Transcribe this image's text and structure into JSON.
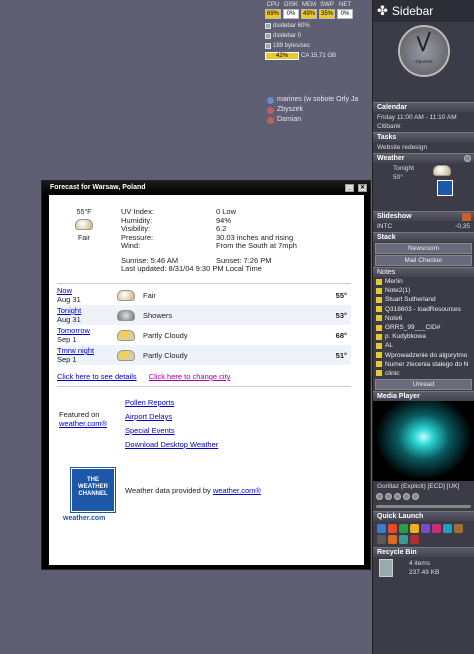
{
  "meters": {
    "headers": [
      "CPU",
      "DISK",
      "MEM",
      "SWP",
      "NET"
    ],
    "values": [
      "69%",
      "0%",
      "49%",
      "35%",
      "0%"
    ],
    "highlight": [
      true,
      false,
      true,
      true,
      false
    ],
    "net_in": "dsidebar 60%",
    "net_out": "dsidebar 0",
    "bytes": "189 bytes/sec",
    "disk_pct": "42%",
    "disk_label": "CA 15,71 GB"
  },
  "contacts": [
    {
      "name": "marines (w sobote Orly Ja"
    },
    {
      "name": "Zbyszek"
    },
    {
      "name": "Damian"
    }
  ],
  "forecast_window": {
    "title": "Forecast for Warsaw, Poland",
    "current": {
      "temp": "55°F",
      "condition": "Fair",
      "uv_label": "UV Index:",
      "uv": "0 Low",
      "humidity_label": "Humidity:",
      "humidity": "94%",
      "visibility_label": "Visibility:",
      "visibility": "6.2",
      "pressure_label": "Pressure:",
      "pressure": "30.03 inches and rising",
      "wind_label": "Wind:",
      "wind": "From the South at 7mph",
      "sunrise": "Sunrise: 5:46 AM",
      "sunset": "Sunset: 7:26 PM",
      "updated": "Last updated: 8/31/04 9:30 PM Local Time"
    },
    "days": [
      {
        "day": "Now",
        "date": "Aug 31",
        "condition": "Fair",
        "temp": "55°"
      },
      {
        "day": "Tonight",
        "date": "Aug 31",
        "condition": "Showers",
        "temp": "53°"
      },
      {
        "day": "Tomorrow",
        "date": "Sep 1",
        "condition": "Partly Cloudy",
        "temp": "68°"
      },
      {
        "day": "Tmrw night",
        "date": "Sep 1",
        "condition": "Partly Cloudy",
        "temp": "51°"
      }
    ],
    "details_link": "Click here to see details",
    "city_link": "Click here to change city",
    "featured": "Featured on",
    "featured_link": "weather.com®",
    "links": [
      "Pollen Reports",
      "Airport Delays",
      "Special Events",
      "Download Desktop Weather"
    ],
    "logo_text": "THE WEATHER CHANNEL",
    "logo_sub": "weather.com",
    "provided_by": "Weather data provided by",
    "provided_link": "weather.com®"
  },
  "sidebar": {
    "title": "Sidebar",
    "clock_label": "OpusOS",
    "calendar": {
      "label": "Calendar",
      "line1": "Friday 11:00 AM - 11:10 AM",
      "line2": "Citibank"
    },
    "tasks": {
      "label": "Tasks",
      "item": "Website redesign"
    },
    "weather": {
      "label": "Weather",
      "period": "Tonight",
      "temp": "50°"
    },
    "slideshow": {
      "label": "Slideshow"
    },
    "ticker": {
      "symbol": "INTC",
      "change": "-0,35"
    },
    "stack": {
      "label": "Stack",
      "items": [
        "Newsroom",
        "Mail Checker",
        "Notes"
      ]
    },
    "notes": [
      "Merlin",
      "Note2(1)",
      "Stuart Sutherland",
      "Q318603 - loadResources",
      "Note6",
      "GRRS_99___CID#",
      "p. Kudybkowa",
      "AL",
      "Wprowadzenie do algorytmo",
      "Numer zlecenia stałego do N",
      "clinic"
    ],
    "unread": "Unread",
    "media": {
      "label": "Media Player",
      "track": "Gorillaz (Explicit) [ECD] [UK]"
    },
    "quick_launch": {
      "label": "Quick Launch"
    },
    "recycle": {
      "label": "Recycle Bin",
      "items": "4 items",
      "size": "237.49 KB"
    },
    "colors": [
      "#3a7bd5",
      "#e84a2a",
      "#2a9d4a",
      "#f0b020",
      "#7a4ad0",
      "#d02a7a",
      "#20a0c0",
      "#a07030",
      "#5a5a5a",
      "#e06a20",
      "#3a9a9a",
      "#b03030",
      "#3060a0",
      "#70a030"
    ]
  }
}
